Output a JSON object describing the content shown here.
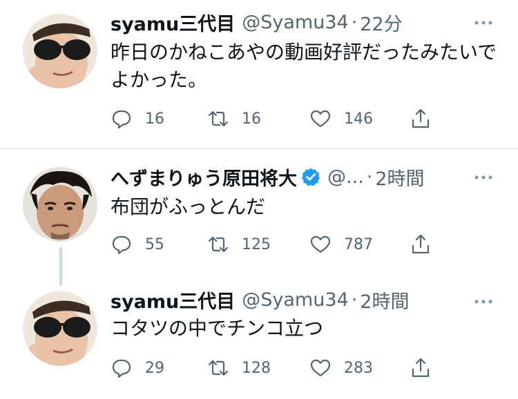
{
  "tweets": [
    {
      "name": "syamu三代目",
      "handle": "@Syamu34",
      "dot": "·",
      "time": "22分",
      "text": "昨日のかねこあやの動画好評だったみたいでよかった。",
      "replies": "16",
      "retweets": "16",
      "likes": "146"
    },
    {
      "name": "へずまりゅう原田将大",
      "handle": "@...",
      "dot": "·",
      "time": "2時間",
      "verified": true,
      "text": "布団がふっとんだ",
      "replies": "55",
      "retweets": "125",
      "likes": "787"
    },
    {
      "name": "syamu三代目",
      "handle": "@Syamu34",
      "dot": "·",
      "time": "2時間",
      "text": "コタツの中でチンコ立つ",
      "replies": "29",
      "retweets": "128",
      "likes": "283"
    }
  ],
  "icons": {
    "reply": "reply-icon",
    "retweet": "retweet-icon",
    "like": "heart-icon",
    "share": "share-icon",
    "more": "more-icon",
    "verified": "verified-badge-icon"
  },
  "colors": {
    "text": "#0f1419",
    "secondary": "#536471",
    "verified": "#1d9bf0",
    "divider": "#e1e6ea",
    "thread_line": "#cfd9de"
  }
}
